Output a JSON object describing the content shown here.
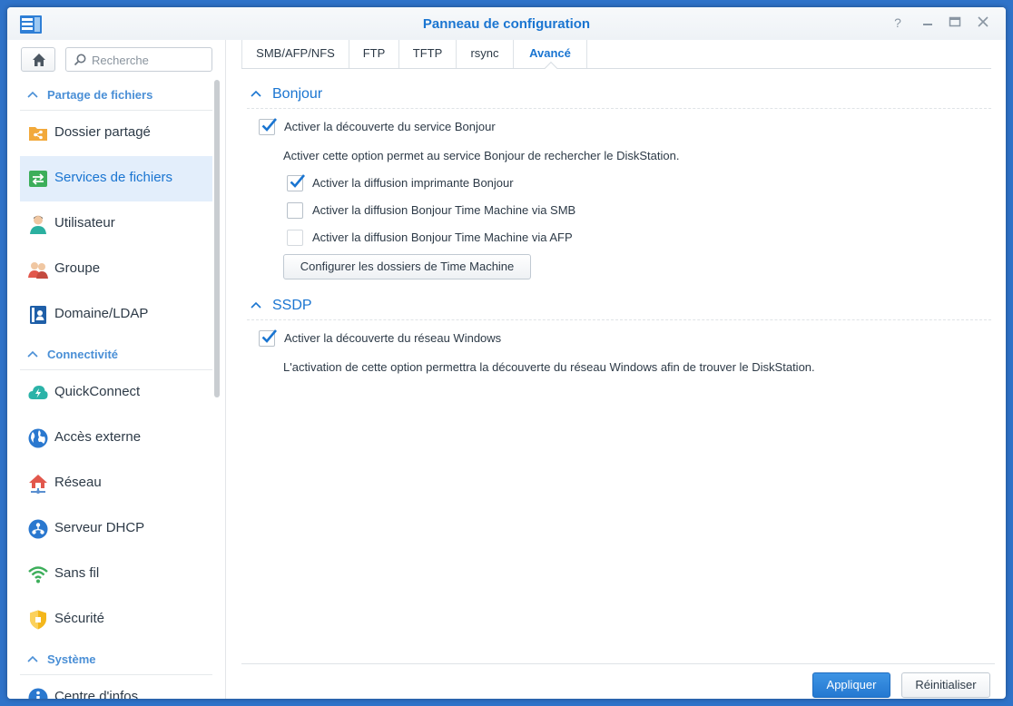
{
  "window": {
    "title": "Panneau de configuration",
    "controls": [
      "help",
      "minimize",
      "maximize",
      "close"
    ]
  },
  "sidebar": {
    "search_placeholder": "Recherche",
    "sections": [
      {
        "label": "Partage de fichiers",
        "items": [
          {
            "label": "Dossier partagé",
            "icon": "shared-folder-icon",
            "active": false
          },
          {
            "label": "Services de fichiers",
            "icon": "file-services-icon",
            "active": true
          },
          {
            "label": "Utilisateur",
            "icon": "user-icon",
            "active": false
          },
          {
            "label": "Groupe",
            "icon": "group-icon",
            "active": false
          },
          {
            "label": "Domaine/LDAP",
            "icon": "domain-ldap-icon",
            "active": false
          }
        ]
      },
      {
        "label": "Connectivité",
        "items": [
          {
            "label": "QuickConnect",
            "icon": "quickconnect-icon",
            "active": false
          },
          {
            "label": "Accès externe",
            "icon": "external-access-icon",
            "active": false
          },
          {
            "label": "Réseau",
            "icon": "network-icon",
            "active": false
          },
          {
            "label": "Serveur DHCP",
            "icon": "dhcp-server-icon",
            "active": false
          },
          {
            "label": "Sans fil",
            "icon": "wireless-icon",
            "active": false
          },
          {
            "label": "Sécurité",
            "icon": "security-icon",
            "active": false
          }
        ]
      },
      {
        "label": "Système",
        "items": [
          {
            "label": "Centre d'infos",
            "icon": "info-center-icon",
            "active": false
          }
        ]
      }
    ]
  },
  "tabs": [
    {
      "label": "SMB/AFP/NFS",
      "active": false
    },
    {
      "label": "FTP",
      "active": false
    },
    {
      "label": "TFTP",
      "active": false
    },
    {
      "label": "rsync",
      "active": false
    },
    {
      "label": "Avancé",
      "active": true
    }
  ],
  "bonjour": {
    "title": "Bonjour",
    "enable_label": "Activer la découverte du service Bonjour",
    "enable_checked": true,
    "description": "Activer cette option permet au service Bonjour de rechercher le DiskStation.",
    "options": [
      {
        "label": "Activer la diffusion imprimante Bonjour",
        "checked": true
      },
      {
        "label": "Activer la diffusion Bonjour Time Machine via SMB",
        "checked": false
      },
      {
        "label": "Activer la diffusion Bonjour Time Machine via AFP",
        "checked": false
      }
    ],
    "configure_button": "Configurer les dossiers de Time Machine"
  },
  "ssdp": {
    "title": "SSDP",
    "enable_label": "Activer la découverte du réseau Windows",
    "enable_checked": true,
    "description": "L'activation de cette option permettra la découverte du réseau Windows afin de trouver le DiskStation."
  },
  "footer": {
    "apply_label": "Appliquer",
    "reset_label": "Réinitialiser"
  },
  "colors": {
    "accent": "#1a75d1",
    "section_header": "#4a8fd6",
    "active_item_bg": "#e3eefb",
    "desktop": "#2f73c9"
  }
}
